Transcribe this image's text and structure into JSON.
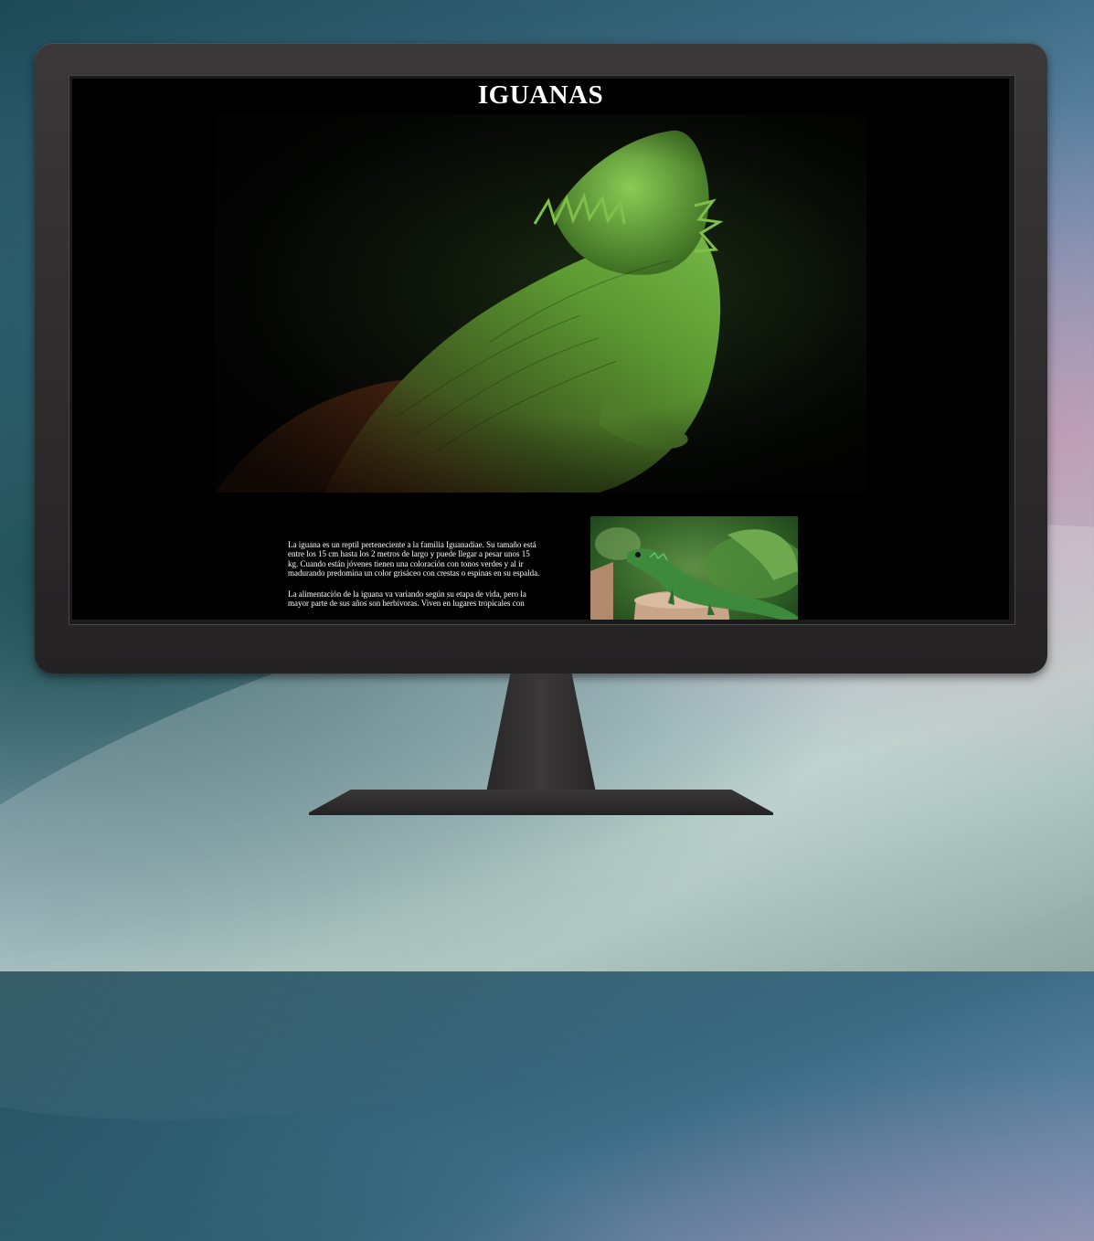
{
  "page": {
    "title": "IGUANAS"
  },
  "hero_image": {
    "alt": "iguana-green-dark-background"
  },
  "content": {
    "paragraphs": [
      "La iguana es un reptil perteneciente a la familia Iguanadiae. Su tamaño está entre los 15 cm hasta los 2 metros de largo y puede llegar a pesar unos 15 kg. Cuando están jóvenes tienen una coloración con tonos verdes y al ir madurando predomina un color grisáceo con crestas o espinas en su espalda.",
      "La alimentación de la iguana va variando según su etapa de vida, pero la mayor parte de sus años son herbívoras. Viven en lugares tropicales con"
    ]
  },
  "side_image": {
    "alt": "small-green-lizard-on-stump"
  },
  "colors": {
    "screen_background": "#000000",
    "monitor_bezel": "#2e2c2d",
    "text": "#ffffff"
  }
}
